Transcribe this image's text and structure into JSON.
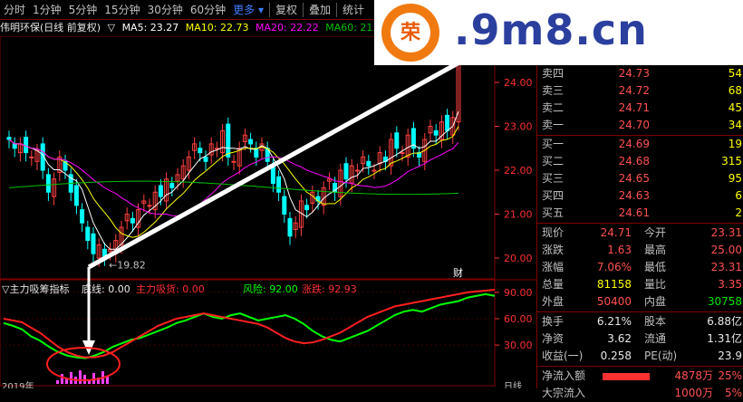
{
  "toolbar": {
    "tabs": [
      "分时",
      "1分钟",
      "5分钟",
      "15分钟",
      "30分钟",
      "60分钟"
    ],
    "more": "更多",
    "right": [
      "复权",
      "叠加",
      "统计"
    ]
  },
  "info": {
    "title": "伟明环保(日线 前复权)",
    "marker": "▽",
    "ma5": "MA5: 23.27",
    "ma10": "MA10: 22.73",
    "ma20": "MA20: 22.22",
    "ma60": "MA60: 21.72"
  },
  "logo": {
    "badge": "荣",
    "site": ".9m8.cn"
  },
  "axis_price": [
    "24.00",
    "23.00",
    "22.00",
    "21.00",
    "20.00"
  ],
  "axis_ind": [
    "90.00",
    "60.00",
    "30.00"
  ],
  "low_label": "←19.82",
  "cai_label": "财",
  "indicator": {
    "name": "▽主力吸筹指标",
    "base": "底线: 0.00",
    "main": "主力吸货: 0.00",
    "risk": "风险: 92.00",
    "rise": "涨跌: 92.93"
  },
  "bottom_left": "2019年",
  "bottom_right": "日线",
  "colors": {
    "up": "#ff4040",
    "down": "#00ffff",
    "ma5": "#ffffff",
    "ma10": "#ffff00",
    "ma20": "#ff00ff",
    "ma60": "#00c000",
    "risk": "#00ff00",
    "rise": "#ff2020"
  },
  "quote": {
    "asks": [
      {
        "label": "卖四",
        "price": "24.73",
        "vol": "54"
      },
      {
        "label": "卖三",
        "price": "24.72",
        "vol": "68"
      },
      {
        "label": "卖二",
        "price": "24.71",
        "vol": "45"
      },
      {
        "label": "卖一",
        "price": "24.70",
        "vol": "34"
      }
    ],
    "bids": [
      {
        "label": "买一",
        "price": "24.69",
        "vol": "19"
      },
      {
        "label": "买二",
        "price": "24.68",
        "vol": "315"
      },
      {
        "label": "买三",
        "price": "24.65",
        "vol": "95"
      },
      {
        "label": "买四",
        "price": "24.63",
        "vol": "6"
      },
      {
        "label": "买五",
        "price": "24.61",
        "vol": "2"
      }
    ],
    "stats": [
      {
        "l1": "现价",
        "v1": "24.71",
        "c1": "red",
        "l2": "今开",
        "v2": "23.31",
        "c2": "red"
      },
      {
        "l1": "涨跌",
        "v1": "1.63",
        "c1": "red",
        "l2": "最高",
        "v2": "25.00",
        "c2": "red"
      },
      {
        "l1": "涨幅",
        "v1": "7.06%",
        "c1": "red",
        "l2": "最低",
        "v2": "23.31",
        "c2": "red"
      },
      {
        "l1": "总量",
        "v1": "81158",
        "c1": "yel",
        "l2": "量比",
        "v2": "3.35",
        "c2": "red"
      },
      {
        "l1": "外盘",
        "v1": "50400",
        "c1": "red",
        "l2": "内盘",
        "v2": "30758",
        "c2": "grn"
      }
    ],
    "stats2": [
      {
        "l1": "换手",
        "v1": "6.21%",
        "c1": "wht",
        "l2": "股本",
        "v2": "6.88亿",
        "c2": "wht"
      },
      {
        "l1": "净资",
        "v1": "3.62",
        "c1": "wht",
        "l2": "流通",
        "v2": "1.31亿",
        "c2": "wht"
      },
      {
        "l1": "收益(一)",
        "v1": "0.258",
        "c1": "wht",
        "l2": "PE(动)",
        "v2": "23.9",
        "c2": "wht"
      }
    ],
    "flow": {
      "label": "净流入额",
      "value": "4878万",
      "pct": "25%"
    },
    "flow2": {
      "label": "大宗流入",
      "value": "1000万",
      "pct": "5%"
    }
  }
}
